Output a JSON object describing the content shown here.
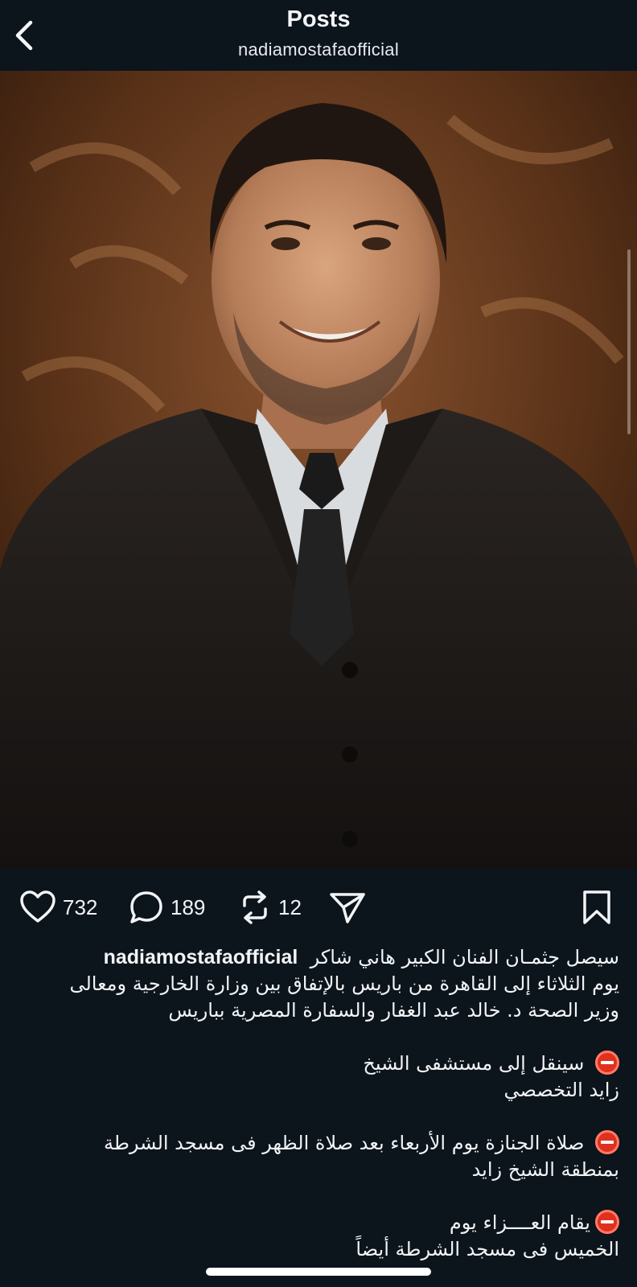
{
  "header": {
    "title": "Posts",
    "username": "nadiamostafaofficial"
  },
  "post": {
    "image_alt": "Portrait photo of a smiling man in a dark three-piece suit and tie",
    "likes": "732",
    "comments": "189",
    "reposts": "12"
  },
  "caption": {
    "username": "nadiamostafaofficial",
    "line1": "سيصل جثمـان  الفنان الكبير هاني شاكر",
    "line2": "يوم الثلاثاء  إلى القاهرة من باريس بالإتفاق بين وزارة الخارجية  ومعالى",
    "line3": "وزير الصحة  د. خالد عبد الغفار  والسفارة المصرية بباريس",
    "item1_line1": "سينقل إلى مستشفى  الشيخ",
    "item1_line2": "زايد التخصصي",
    "item2_line1": "صلاة الجنازة يوم الأربعاء بعد صلاة الظهر فى مسجد الشرطة",
    "item2_line2": "بمنطقة الشيخ زايد",
    "item3_line1": "يقام العــــزاء  يوم",
    "item3_line2": "الخميس فى مسجد الشرطة أيضاً"
  },
  "colors": {
    "background": "#0c141c",
    "text": "#f2f4f6",
    "stop_emoji": "#e0301e"
  },
  "icons": [
    "back-chevron-icon",
    "heart-icon",
    "comment-icon",
    "repost-icon",
    "share-icon",
    "bookmark-icon",
    "stop-sign-icon"
  ]
}
